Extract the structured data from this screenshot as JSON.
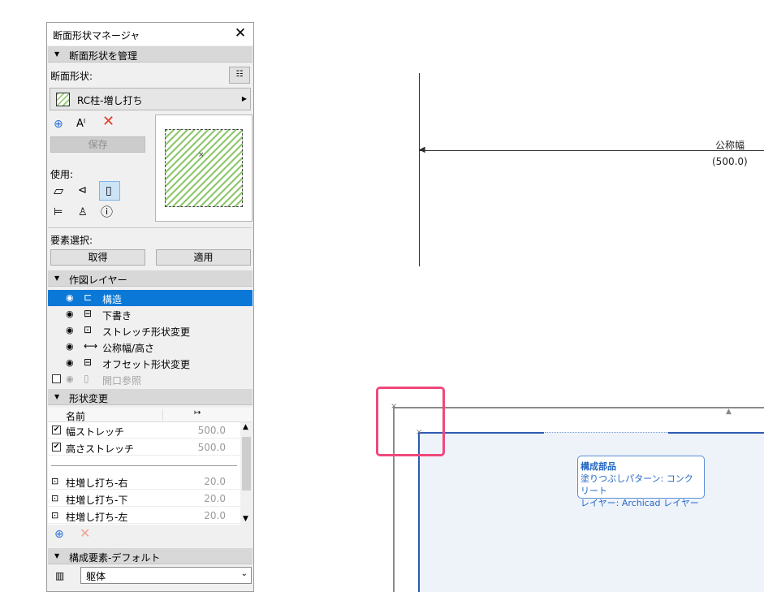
{
  "palette": {
    "title": "断面形状マネージャ",
    "close_glyph": "✕",
    "manage_section": "断面形状を管理",
    "profile_label": "断面形状:",
    "profile_name": "RC柱-増し打ち",
    "save_button": "保存",
    "usage_label": "使用:",
    "element_select_label": "要素選択:",
    "get_button": "取得",
    "apply_button": "適用",
    "layers_section": "作図レイヤー",
    "layers": [
      {
        "label": "構造",
        "icon": "⊏",
        "visible": true
      },
      {
        "label": "下書き",
        "icon": "⊟",
        "visible": true
      },
      {
        "label": "ストレッチ形状変更",
        "icon": "⊡",
        "visible": true
      },
      {
        "label": "公称幅/高さ",
        "icon": "⟷",
        "visible": true
      },
      {
        "label": "オフセット形状変更",
        "icon": "⊟",
        "visible": true
      },
      {
        "label": "開口参照",
        "icon": "▯",
        "visible": false
      }
    ],
    "modify_section": "形状変更",
    "table": {
      "col_name": "名前",
      "col_icon": "↦",
      "rows": [
        {
          "name": "幅ストレッチ",
          "value": "500.0",
          "checked": true,
          "kind": "check"
        },
        {
          "name": "高さストレッチ",
          "value": "500.0",
          "checked": true,
          "kind": "check"
        },
        {
          "name": "柱増し打ち-右",
          "value": "20.0",
          "kind": "offset"
        },
        {
          "name": "柱増し打ち-下",
          "value": "20.0",
          "kind": "offset"
        },
        {
          "name": "柱増し打ち-左",
          "value": "20.0",
          "kind": "offset"
        }
      ]
    },
    "component_section": "構成要素-デフォルト",
    "component_value": "躯体"
  },
  "canvas": {
    "dimension_label": "公称幅",
    "dimension_value": "(500.0)",
    "tooltip": {
      "heading": "構成部品",
      "line1": "塗りつぶしパターン: コンクリート",
      "line2": "レイヤー: Archicad レイヤー"
    }
  }
}
